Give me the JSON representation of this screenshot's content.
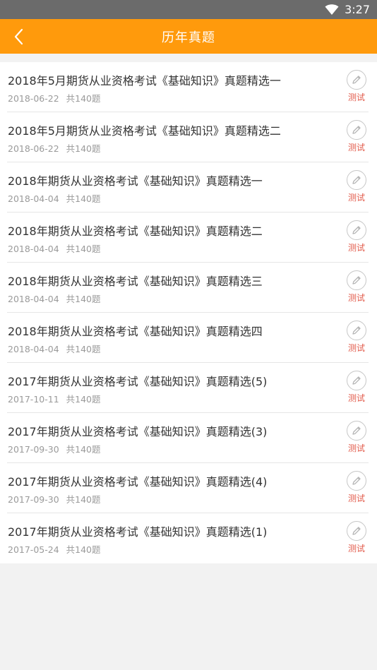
{
  "status_bar": {
    "time": "3:27",
    "icons": [
      "wifi-icon"
    ]
  },
  "app_bar": {
    "title": "历年真题",
    "back_icon": "chevron-left-icon"
  },
  "colors": {
    "accent": "#ff9a0c",
    "test_label": "#e25a4a"
  },
  "items": [
    {
      "title": "2018年5月期货从业资格考试《基础知识》真题精选一",
      "date": "2018-06-22",
      "count": "共140题",
      "action": "测试"
    },
    {
      "title": "2018年5月期货从业资格考试《基础知识》真题精选二",
      "date": "2018-06-22",
      "count": "共140题",
      "action": "测试"
    },
    {
      "title": "2018年期货从业资格考试《基础知识》真题精选一",
      "date": "2018-04-04",
      "count": "共140题",
      "action": "测试"
    },
    {
      "title": "2018年期货从业资格考试《基础知识》真题精选二",
      "date": "2018-04-04",
      "count": "共140题",
      "action": "测试"
    },
    {
      "title": "2018年期货从业资格考试《基础知识》真题精选三",
      "date": "2018-04-04",
      "count": "共140题",
      "action": "测试"
    },
    {
      "title": "2018年期货从业资格考试《基础知识》真题精选四",
      "date": "2018-04-04",
      "count": "共140题",
      "action": "测试"
    },
    {
      "title": "2017年期货从业资格考试《基础知识》真题精选(5)",
      "date": "2017-10-11",
      "count": "共140题",
      "action": "测试"
    },
    {
      "title": "2017年期货从业资格考试《基础知识》真题精选(3)",
      "date": "2017-09-30",
      "count": "共140题",
      "action": "测试"
    },
    {
      "title": "2017年期货从业资格考试《基础知识》真题精选(4)",
      "date": "2017-09-30",
      "count": "共140题",
      "action": "测试"
    },
    {
      "title": "2017年期货从业资格考试《基础知识》真题精选(1)",
      "date": "2017-05-24",
      "count": "共140题",
      "action": "测试"
    }
  ]
}
